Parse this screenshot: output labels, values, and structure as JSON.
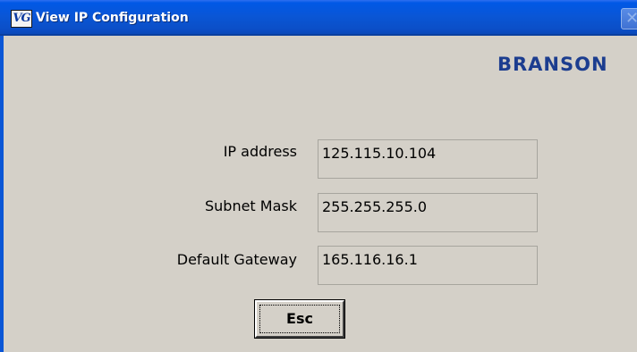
{
  "window": {
    "title": "View IP Configuration",
    "icon": "VG"
  },
  "brand": "BRANSON",
  "fields": {
    "ip": {
      "label": "IP address",
      "value": "125.115.10.104"
    },
    "subnet": {
      "label": "Subnet Mask",
      "value": "255.255.255.0"
    },
    "gateway": {
      "label": "Default Gateway",
      "value": "165.116.16.1"
    }
  },
  "actions": {
    "esc_label": "Esc"
  },
  "colors": {
    "titlebar": "#0a56d6",
    "window_bg": "#d4d0c8",
    "brand": "#1c3d8f"
  }
}
